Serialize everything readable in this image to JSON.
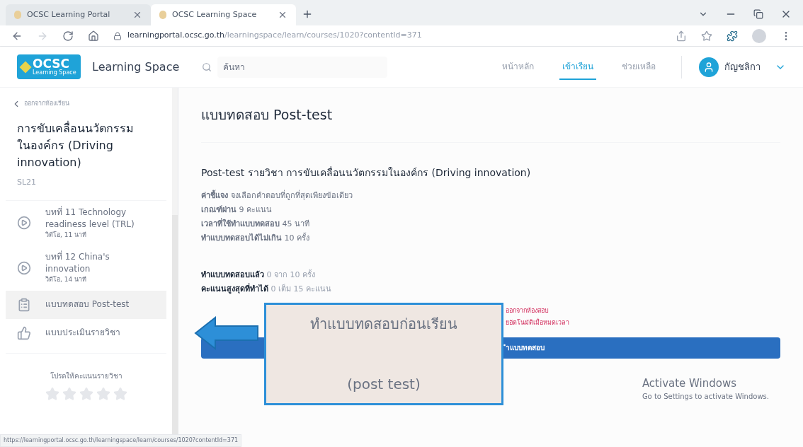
{
  "browser": {
    "tabs": [
      {
        "title": "OCSC Learning Portal",
        "selected": false
      },
      {
        "title": "OCSC Learning Space",
        "selected": true
      }
    ],
    "url_host": "learningportal.ocsc.go.th",
    "url_path": "/learningspace/learn/courses/1020?contentId=371",
    "status_url": "https://learningportal.ocsc.go.th/learningspace/learn/courses/1020?contentId=371"
  },
  "header": {
    "logo_text": "OCSC",
    "logo_subtext": "Learning Space",
    "site_title": "Learning Space",
    "search_placeholder": "ค้นหา",
    "nav": [
      {
        "label": "หน้าหลัก",
        "selected": false
      },
      {
        "label": "เข้าเรียน",
        "selected": true
      },
      {
        "label": "ช่วยเหลือ",
        "selected": false
      }
    ],
    "user_name": "กัญชลิกา"
  },
  "sidebar": {
    "back": "ออกจากห้องเรียน",
    "course_title": "การขับเคลื่อนนวัตกรรมในองค์กร (Driving innovation)",
    "course_code": "SL21",
    "items": [
      {
        "kind": "video",
        "title": "บทที่ 11 Technology readiness level (TRL)",
        "meta": "วิดีโอ, 11 นาที",
        "selected": false
      },
      {
        "kind": "video",
        "title": "บทที่ 12 China's innovation",
        "meta": "วิดีโอ, 14 นาที",
        "selected": false
      },
      {
        "kind": "test",
        "title": "แบบทดสอบ Post-test",
        "selected": true
      },
      {
        "kind": "survey",
        "title": "แบบประเมินรายวิชา",
        "selected": false
      }
    ],
    "rating_prompt": "โปรดให้คะแนนรายวิชา",
    "stars": 0
  },
  "content": {
    "heading": "แบบทดสอบ Post-test",
    "test_title": "Post-test รายวิชา การขับเคลื่อนนวัตกรรมในองค์กร (Driving innovation)",
    "info": [
      {
        "label": "ค่าชี้แจง",
        "value": "จงเลือกคำตอบที่ถูกที่สุดเพียงข้อเดียว"
      },
      {
        "label": "เกณฑ์ผ่าน",
        "value": "9 คะแนน"
      },
      {
        "label": "เวลาที่ใช้ทำแบบทดสอบ",
        "value": "45 นาที"
      },
      {
        "label": "ทำแบบทดสอบได้ไม่เกิน",
        "value": "10 ครั้ง"
      }
    ],
    "progress": [
      {
        "label": "ทำแบบทดสอบแล้ว",
        "value": "0 จาก 10 ครั้ง"
      },
      {
        "label": "คะแนนสูงสุดที่ทำได้",
        "value": "0 เต็ม 15 คะแนน"
      }
    ],
    "notes": [
      "ออกจากห้องสอบ",
      "ยอัตโนมัติเมื่อหมดเวลา"
    ],
    "start_button": "ำแบบทดสอบ"
  },
  "callout": {
    "line_1": "ทำแบบทดสอบก่อนเรียน",
    "line_2": "(post test)"
  },
  "os_watermark": {
    "title": "Activate Windows",
    "subtitle": "Go to Settings to activate Windows."
  }
}
